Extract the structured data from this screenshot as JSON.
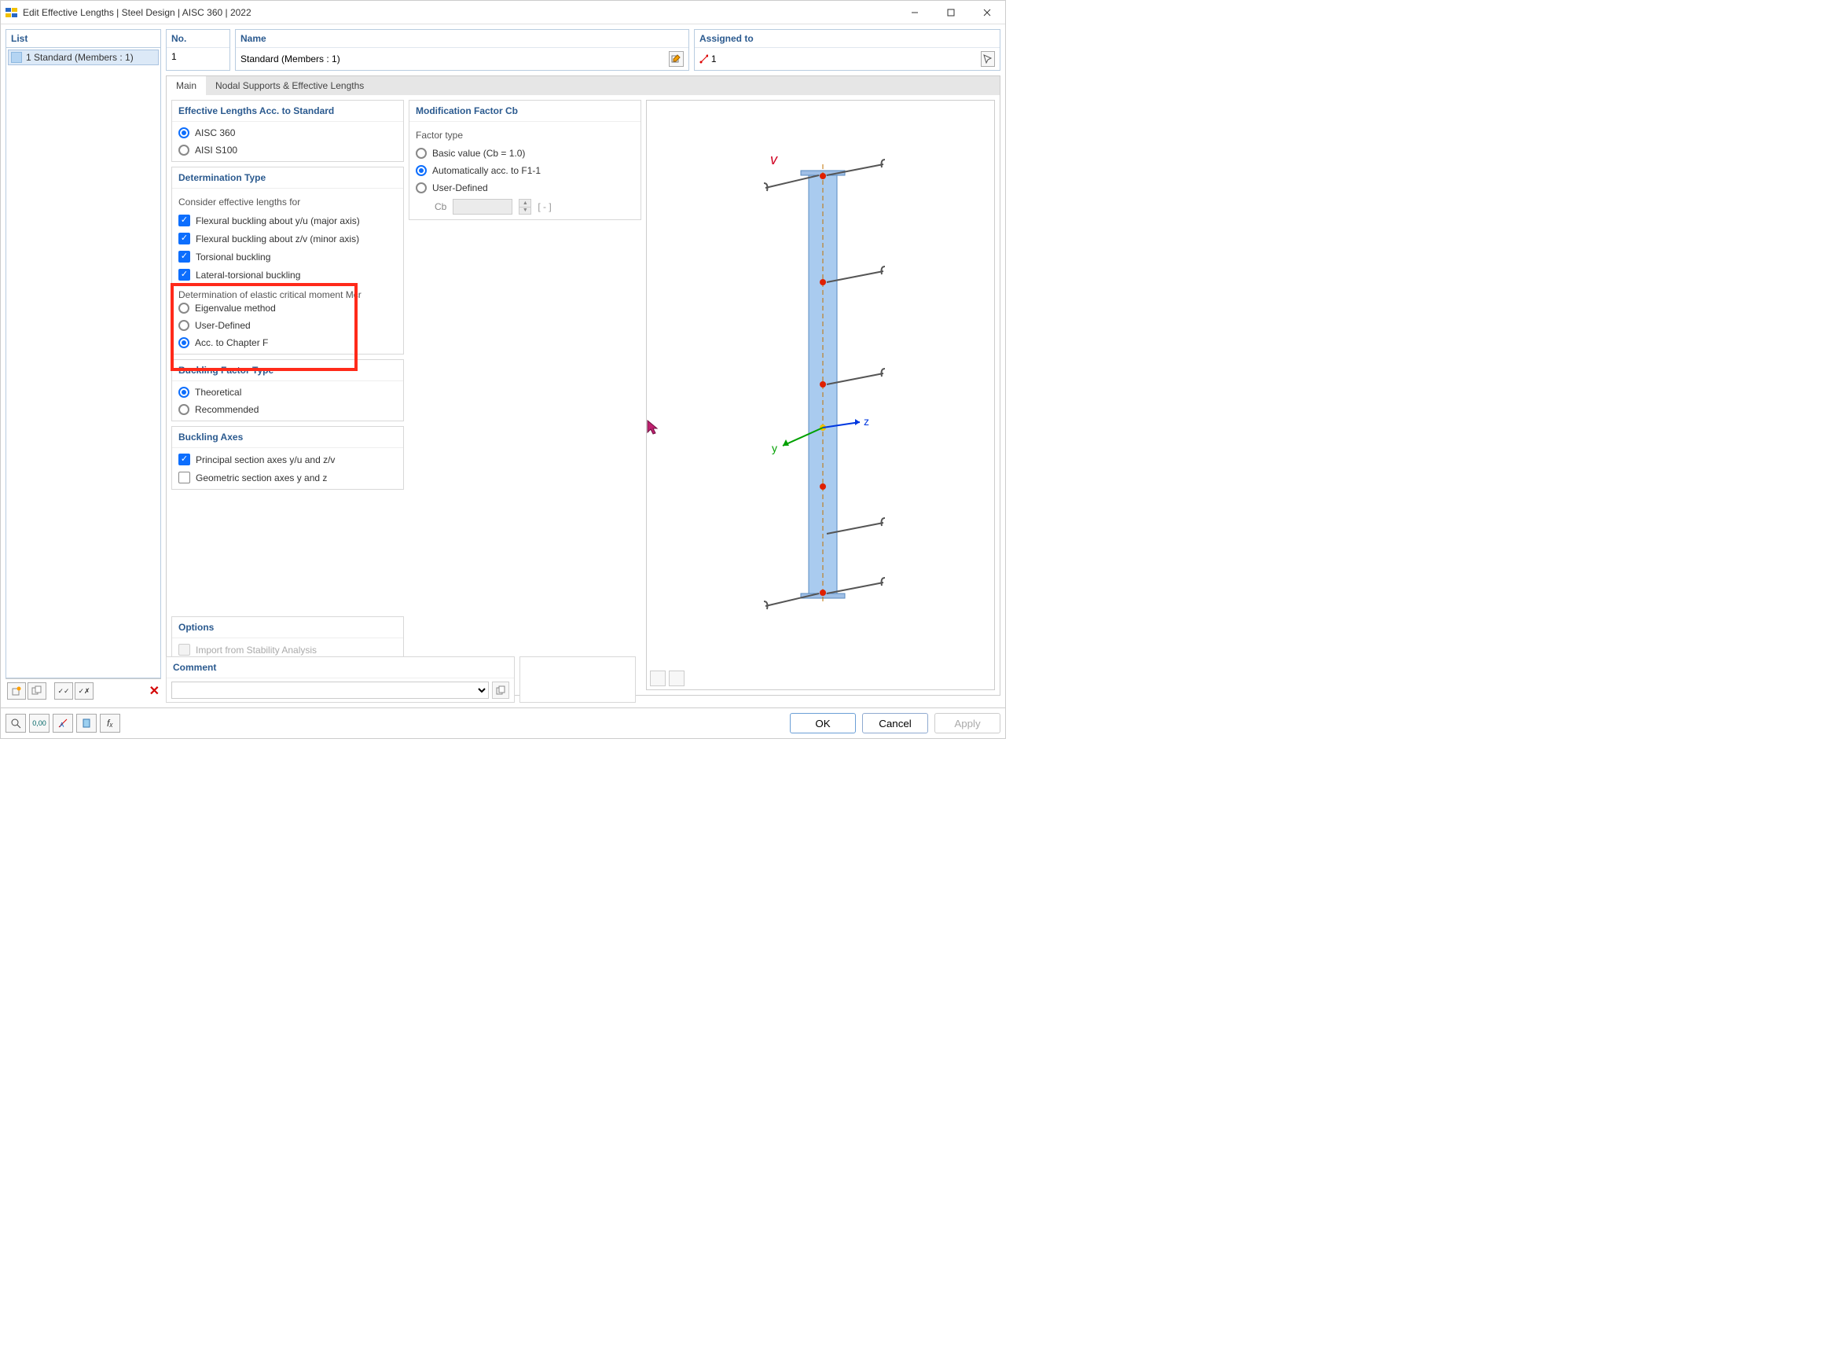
{
  "titlebar": {
    "title": "Edit Effective Lengths | Steel Design | AISC 360 | 2022"
  },
  "sidebar": {
    "head": "List",
    "item": "1 Standard (Members : 1)"
  },
  "fields": {
    "no_label": "No.",
    "no_value": "1",
    "name_label": "Name",
    "name_value": "Standard (Members : 1)",
    "assigned_label": "Assigned to",
    "assigned_value": "1"
  },
  "tabs": {
    "main": "Main",
    "nodal": "Nodal Supports & Effective Lengths"
  },
  "eff_std": {
    "head": "Effective Lengths Acc. to Standard",
    "aisc360": "AISC 360",
    "aisi": "AISI S100"
  },
  "det_type": {
    "head": "Determination Type",
    "consider": "Consider effective lengths for",
    "c1": "Flexural buckling about y/u (major axis)",
    "c2": "Flexural buckling about z/v (minor axis)",
    "c3": "Torsional buckling",
    "c4": "Lateral-torsional buckling",
    "moment": "Determination of elastic critical moment Mcr",
    "r1": "Eigenvalue method",
    "r2": "User-Defined",
    "r3": "Acc. to Chapter F"
  },
  "bft": {
    "head": "Buckling Factor Type",
    "r1": "Theoretical",
    "r2": "Recommended"
  },
  "axes": {
    "head": "Buckling Axes",
    "c1": "Principal section axes y/u and z/v",
    "c2": "Geometric section axes y and z"
  },
  "opts": {
    "head": "Options",
    "c1": "Import from Stability Analysis"
  },
  "cb": {
    "head": "Modification Factor Cb",
    "ftype": "Factor type",
    "r1": "Basic value (Cb = 1.0)",
    "r2": "Automatically acc. to F1-1",
    "r3": "User-Defined",
    "sym": "Cb",
    "unit": "[ - ]"
  },
  "comment": {
    "head": "Comment"
  },
  "buttons": {
    "ok": "OK",
    "cancel": "Cancel",
    "apply": "Apply"
  }
}
